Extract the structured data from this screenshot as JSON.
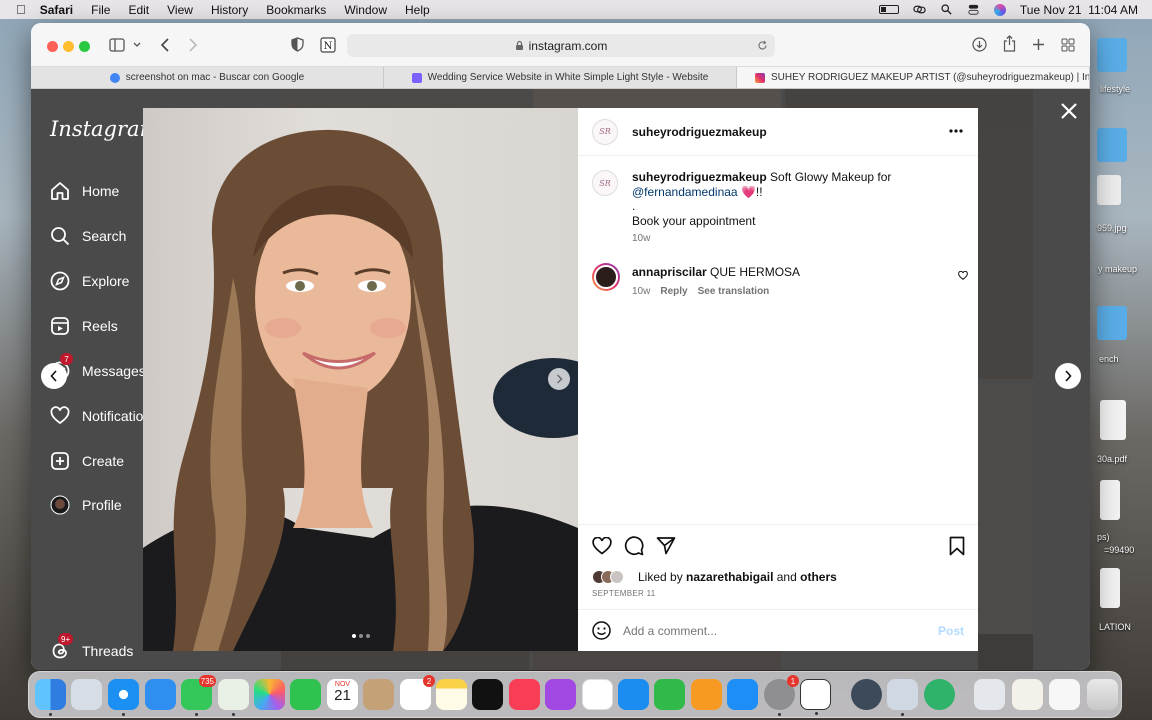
{
  "menubar": {
    "app": "Safari",
    "items": [
      "File",
      "Edit",
      "View",
      "History",
      "Bookmarks",
      "Window",
      "Help"
    ],
    "datetime": "Tue Nov 21  11:04 AM"
  },
  "browser": {
    "address": "instagram.com",
    "tabs": [
      {
        "title": "screenshot on mac - Buscar con Google",
        "favicon_color": "#4285f4"
      },
      {
        "title": "Wedding Service Website in White Simple Light Style - Website",
        "favicon_color": "#7b61ff"
      },
      {
        "title": "SUHEY RODRIGUEZ MAKEUP ARTIST (@suheyrodriguezmakeup) | Inst...",
        "favicon_color": "#e1306c"
      }
    ]
  },
  "instagram": {
    "logo": "Instagram",
    "nav": [
      {
        "label": "Home",
        "icon": "home-icon"
      },
      {
        "label": "Search",
        "icon": "search-icon"
      },
      {
        "label": "Explore",
        "icon": "explore-icon"
      },
      {
        "label": "Reels",
        "icon": "reels-icon"
      },
      {
        "label": "Messages",
        "icon": "messages-icon",
        "badge": "7"
      },
      {
        "label": "Notifications",
        "icon": "heart-icon"
      },
      {
        "label": "Create",
        "icon": "create-icon"
      },
      {
        "label": "Profile",
        "icon": "profile-icon"
      },
      {
        "label": "Threads",
        "icon": "threads-icon",
        "badge": "9+"
      }
    ]
  },
  "post": {
    "username": "suheyrodriguezmakeup",
    "avatar_text": "SR",
    "caption_user": "suheyrodriguezmakeup",
    "caption_text": "Soft Glowy Makeup for",
    "caption_mention": "@fernandamedinaa",
    "caption_emoji": "💗!!",
    "caption_dot": ".",
    "caption_line2": "Book your appointment",
    "caption_age": "10w",
    "comment_user": "annapriscilar",
    "comment_text": "QUE HERMOSA",
    "comment_age": "10w",
    "reply": "Reply",
    "see_translation": "See translation",
    "liked_prefix": "Liked by",
    "liked_user": "nazarethabigail",
    "liked_and": "and",
    "liked_others": "others",
    "date": "SEPTEMBER 11",
    "comment_placeholder": "Add a comment...",
    "post_button": "Post",
    "carousel_count": 3,
    "carousel_active": 1
  },
  "desktop": {
    "files": [
      "lifestyle",
      "959.jpg",
      "y makeup",
      "ench",
      "30a.pdf",
      "ps)",
      "=99490",
      "LATION"
    ]
  },
  "dock": {
    "badges": {
      "messages": "735",
      "calendar_month": "NOV",
      "calendar_day": "21",
      "reminders": "2",
      "settings": "1"
    }
  }
}
